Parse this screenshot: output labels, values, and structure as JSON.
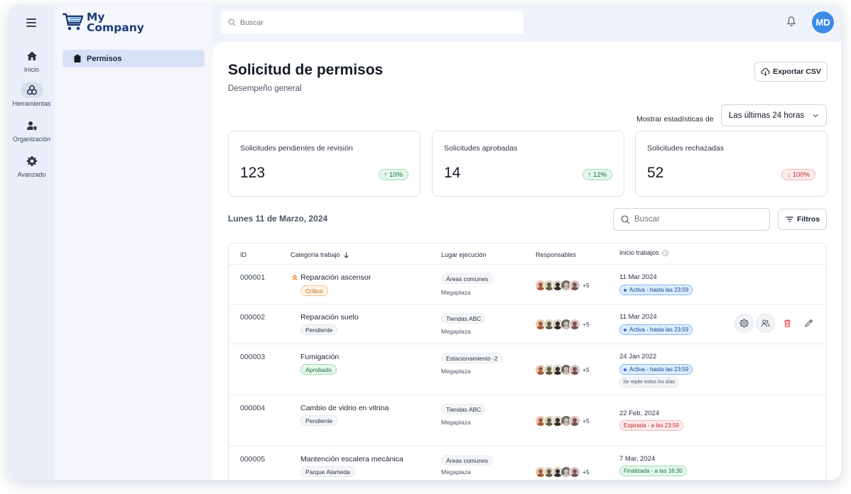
{
  "app": {
    "logo_line1": "My",
    "logo_line2": "Company"
  },
  "rail": [
    {
      "label": "Inicio",
      "icon": "home-icon"
    },
    {
      "label": "Herramientas",
      "icon": "tools-icon"
    },
    {
      "label": "Organización",
      "icon": "users-shield-icon"
    },
    {
      "label": "Avanzado",
      "icon": "gear-icon"
    }
  ],
  "sidebar": {
    "items": [
      {
        "label": "Permisos",
        "icon": "clipboard-icon"
      }
    ]
  },
  "topbar": {
    "search_placeholder": "Buscar",
    "avatar_initials": "MD"
  },
  "page": {
    "title": "Solicitud de permisos",
    "subtitle": "Desempeño general",
    "export_label": "Exportar CSV",
    "stats_label": "Mostrar estadísticas de",
    "stats_range": "Las últimas 24 horas"
  },
  "stats": [
    {
      "label": "Solicitudes pendientes de revisión",
      "value": "123",
      "delta": "10%",
      "direction": "up"
    },
    {
      "label": "Solicitudes aprobadas",
      "value": "14",
      "delta": "12%",
      "direction": "up"
    },
    {
      "label": "Solicitudes rechazadas",
      "value": "52",
      "delta": "100%",
      "direction": "down"
    }
  ],
  "list": {
    "date": "Lunes 11 de Marzo, 2024",
    "search_placeholder": "Buscar",
    "filters_label": "Filtros"
  },
  "table": {
    "columns": [
      "ID",
      "Categoría trabajo",
      "Lugar ejecución",
      "Responsables",
      "Inicio trabajos"
    ],
    "more_label": "+5",
    "rows": [
      {
        "id": "000001",
        "category": "Reparación ascensor",
        "tag": "Crítico",
        "location": "Áreas comunes",
        "site": "Megaplaza",
        "date": "11 Mar 2024",
        "status": "Activa - hasta las 23:59"
      },
      {
        "id": "000002",
        "category": "Reparación suelo",
        "tag": "Pendiente",
        "location": "Tiendas ABC",
        "site": "Megaplaza",
        "date": "11 Mar 2024",
        "status": "Activa - hasta las 23:59"
      },
      {
        "id": "000003",
        "category": "Fumigación",
        "tag": "Aprobado",
        "location": "Estacionamiento -2",
        "site": "Megaplaza",
        "date": "24 Jan 2022",
        "status": "Activa - hasta las 23:59",
        "repeat": "Se repite todos los días"
      },
      {
        "id": "000004",
        "category": "Cambio de vidrio en vitrina",
        "tag": "Pendiente",
        "location": "Tiendas ABC",
        "site": "Megaplaza",
        "date": "22 Feb, 2024",
        "status": "Expirada  - a las 23:59"
      },
      {
        "id": "000005",
        "category": "Mantención escalera mecánica",
        "tag": "Parque Alameda",
        "location": "Áreas comunes",
        "site": "Megaplaza",
        "date": "7 Mar, 2024",
        "status": "Finalizada - a las 16:30"
      }
    ]
  },
  "colors": {
    "accent": "#3d8de6",
    "brand": "#1e3a7a",
    "critical": "#c25f0e",
    "danger": "#e03131"
  }
}
